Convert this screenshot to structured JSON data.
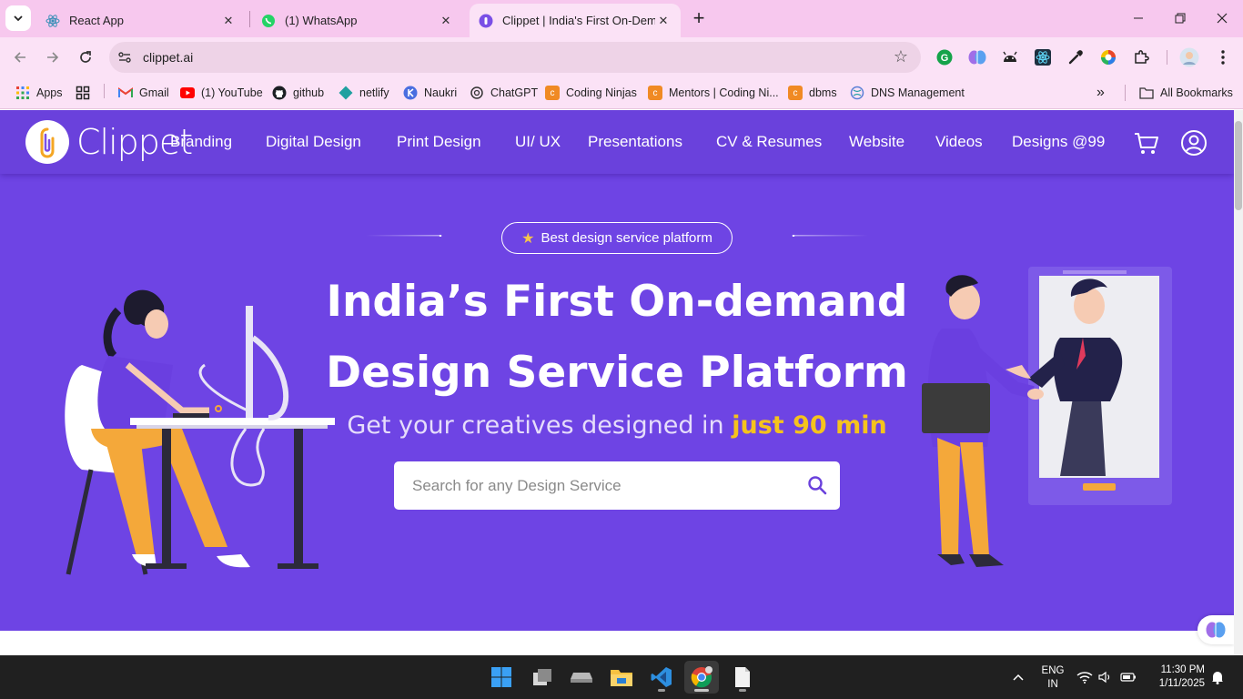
{
  "browser": {
    "tabs": [
      {
        "title": "React App",
        "active": false
      },
      {
        "title": "(1) WhatsApp",
        "active": false
      },
      {
        "title": "Clippet | India's First On-Deman",
        "active": true
      }
    ],
    "url": "clippet.ai",
    "bookmarks": [
      {
        "label": "Apps",
        "icon": "apps-grid-icon"
      },
      {
        "label": "",
        "icon": "tab-groups-icon"
      },
      {
        "label": "Gmail",
        "icon": "gmail-icon"
      },
      {
        "label": "(1) YouTube",
        "icon": "youtube-icon"
      },
      {
        "label": "github",
        "icon": "github-icon"
      },
      {
        "label": "netlify",
        "icon": "netlify-icon"
      },
      {
        "label": "Naukri",
        "icon": "naukri-icon"
      },
      {
        "label": "ChatGPT",
        "icon": "chatgpt-icon"
      },
      {
        "label": "Coding Ninjas",
        "icon": "coding-ninjas-icon"
      },
      {
        "label": "Mentors | Coding Ni...",
        "icon": "coding-ninjas-icon"
      },
      {
        "label": "dbms",
        "icon": "coding-ninjas-icon"
      },
      {
        "label": "DNS Management",
        "icon": "dns-icon"
      }
    ],
    "all_bookmarks": "All Bookmarks",
    "chevron": "»"
  },
  "site": {
    "logo_text": "Clippet",
    "nav": [
      "Branding",
      "Digital Design",
      "Print Design",
      "UI/ UX",
      "Presentations",
      "CV & Resumes",
      "Website",
      "Videos",
      "Designs @99"
    ],
    "badge": "Best design service platform",
    "title_line1": "India’s First On-demand",
    "title_line2": "Design Service Platform",
    "subtitle_prefix": "Get your creatives designed in ",
    "subtitle_highlight": "just 90 min",
    "search_placeholder": "Search for any Design Service"
  },
  "taskbar": {
    "lang_top": "ENG",
    "lang_bottom": "IN",
    "time": "11:30 PM",
    "date": "1/11/2025"
  },
  "colors": {
    "brand_purple": "#6e44e4",
    "highlight_yellow": "#f5c31d",
    "tab_pink": "#f7c8ee"
  }
}
